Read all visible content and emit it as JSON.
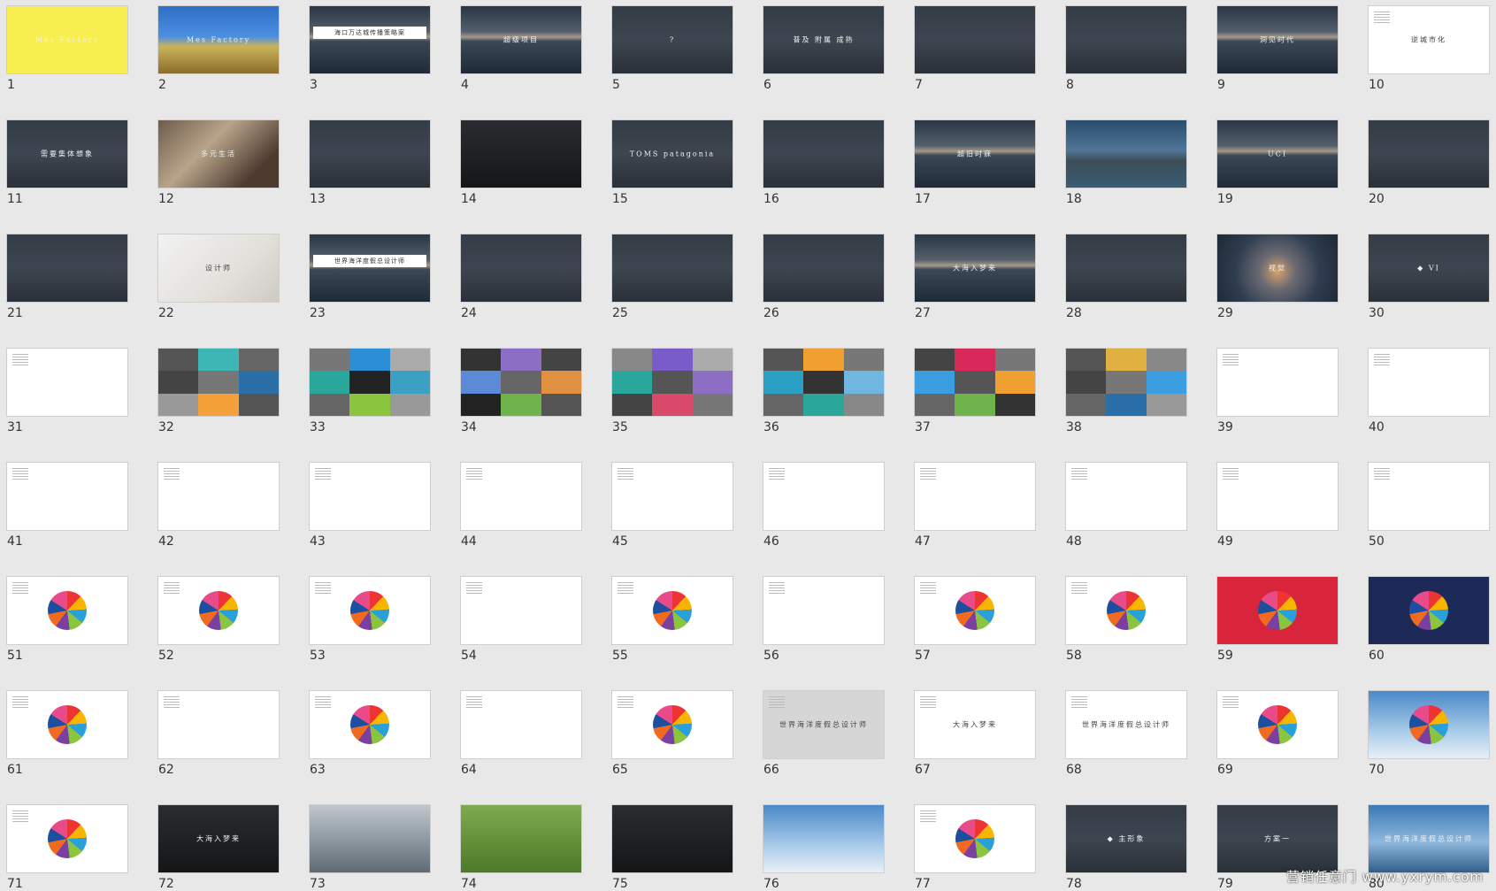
{
  "watermark": "营销任意门 www.yxrym.com",
  "slides": [
    {
      "num": "1",
      "style": "yellow",
      "text": "Mes Factory"
    },
    {
      "num": "2",
      "style": "blue",
      "text": "Mes Factory"
    },
    {
      "num": "3",
      "style": "sea",
      "banner": "海口万达城传播策略案"
    },
    {
      "num": "4",
      "style": "sea",
      "text": "超级项目"
    },
    {
      "num": "5",
      "style": "dark",
      "text": "?"
    },
    {
      "num": "6",
      "style": "dark",
      "text": "普及  附属  成熟"
    },
    {
      "num": "7",
      "style": "dark",
      "text": ""
    },
    {
      "num": "8",
      "style": "dark",
      "text": ""
    },
    {
      "num": "9",
      "style": "sea",
      "text": "洞见时代"
    },
    {
      "num": "10",
      "style": "white",
      "text": "逆城市化",
      "dark": true
    },
    {
      "num": "11",
      "style": "dark",
      "text": "需要集体想象"
    },
    {
      "num": "12",
      "style": "photo1",
      "text": "多元生活"
    },
    {
      "num": "13",
      "style": "dark",
      "text": ""
    },
    {
      "num": "14",
      "style": "dark2",
      "text": ""
    },
    {
      "num": "15",
      "style": "dark",
      "text": "TOMS  patagonia"
    },
    {
      "num": "16",
      "style": "dark",
      "text": ""
    },
    {
      "num": "17",
      "style": "sea",
      "text": "超旧时寐"
    },
    {
      "num": "18",
      "style": "lake",
      "text": ""
    },
    {
      "num": "19",
      "style": "sea",
      "text": "UCI"
    },
    {
      "num": "20",
      "style": "dark",
      "text": ""
    },
    {
      "num": "21",
      "style": "dark",
      "text": ""
    },
    {
      "num": "22",
      "style": "photo2",
      "text": "设计师",
      "dark": true
    },
    {
      "num": "23",
      "style": "sea",
      "banner": "世界海洋度假总设计师"
    },
    {
      "num": "24",
      "style": "dark",
      "text": ""
    },
    {
      "num": "25",
      "style": "dark",
      "text": ""
    },
    {
      "num": "26",
      "style": "dark",
      "text": ""
    },
    {
      "num": "27",
      "style": "sea",
      "text": "大海入梦来"
    },
    {
      "num": "28",
      "style": "dark",
      "text": ""
    },
    {
      "num": "29",
      "style": "glow",
      "text": "视觉"
    },
    {
      "num": "30",
      "style": "dark",
      "text": "◆  VI"
    },
    {
      "num": "31",
      "style": "white",
      "text": ""
    },
    {
      "num": "32",
      "style": "mosaic",
      "colors": [
        "#555",
        "#3fb6b6",
        "#666",
        "#444",
        "#777",
        "#2a6fa8",
        "#999",
        "#f3a23a",
        "#555"
      ]
    },
    {
      "num": "33",
      "style": "mosaic",
      "colors": [
        "#777",
        "#2c8ed6",
        "#aaa",
        "#2aa79b",
        "#222",
        "#3aa0c4",
        "#666",
        "#8bc43f",
        "#999"
      ]
    },
    {
      "num": "34",
      "style": "mosaic",
      "colors": [
        "#333",
        "#8c6fc4",
        "#444",
        "#5b8ad8",
        "#666",
        "#e09040",
        "#222",
        "#6fb44a",
        "#555"
      ]
    },
    {
      "num": "35",
      "style": "mosaic",
      "colors": [
        "#888",
        "#7a5cc8",
        "#aaa",
        "#2aa79b",
        "#555",
        "#8c6fc4",
        "#444",
        "#d94a6a",
        "#777"
      ]
    },
    {
      "num": "36",
      "style": "mosaic",
      "colors": [
        "#555",
        "#f0a030",
        "#777",
        "#2aa0c4",
        "#333",
        "#6fb6e0",
        "#666",
        "#2aa79b",
        "#888"
      ]
    },
    {
      "num": "37",
      "style": "mosaic",
      "colors": [
        "#444",
        "#d9285a",
        "#777",
        "#3a9ee0",
        "#555",
        "#f0a030",
        "#666",
        "#6fb44a",
        "#333"
      ]
    },
    {
      "num": "38",
      "style": "mosaic",
      "colors": [
        "#555",
        "#e0b040",
        "#888",
        "#444",
        "#777",
        "#3a9ee0",
        "#666",
        "#2a6fa8",
        "#999"
      ]
    },
    {
      "num": "39",
      "style": "white",
      "text": ""
    },
    {
      "num": "40",
      "style": "white",
      "text": ""
    },
    {
      "num": "41",
      "style": "white",
      "text": ""
    },
    {
      "num": "42",
      "style": "white",
      "text": ""
    },
    {
      "num": "43",
      "style": "white",
      "text": ""
    },
    {
      "num": "44",
      "style": "white",
      "text": ""
    },
    {
      "num": "45",
      "style": "white",
      "text": ""
    },
    {
      "num": "46",
      "style": "white",
      "text": ""
    },
    {
      "num": "47",
      "style": "white",
      "text": ""
    },
    {
      "num": "48",
      "style": "white",
      "text": ""
    },
    {
      "num": "49",
      "style": "white",
      "text": ""
    },
    {
      "num": "50",
      "style": "white",
      "text": ""
    },
    {
      "num": "51",
      "style": "white",
      "petals": true
    },
    {
      "num": "52",
      "style": "white",
      "petals": true
    },
    {
      "num": "53",
      "style": "white",
      "petals": true
    },
    {
      "num": "54",
      "style": "white",
      "text": ""
    },
    {
      "num": "55",
      "style": "white",
      "petals": true
    },
    {
      "num": "56",
      "style": "white",
      "text": ""
    },
    {
      "num": "57",
      "style": "white",
      "petals": true
    },
    {
      "num": "58",
      "style": "white",
      "petals": true
    },
    {
      "num": "59",
      "style": "red",
      "petals": true
    },
    {
      "num": "60",
      "style": "navy",
      "petals": true
    },
    {
      "num": "61",
      "style": "white",
      "petals": true
    },
    {
      "num": "62",
      "style": "white",
      "text": ""
    },
    {
      "num": "63",
      "style": "white",
      "petals": true
    },
    {
      "num": "64",
      "style": "white",
      "text": ""
    },
    {
      "num": "65",
      "style": "white",
      "petals": true
    },
    {
      "num": "66",
      "style": "gray",
      "text": "世界海洋度假总设计师",
      "dark": true
    },
    {
      "num": "67",
      "style": "white",
      "text": "大海入梦来",
      "dark": true
    },
    {
      "num": "68",
      "style": "white",
      "text": "世界海洋度假总设计师",
      "dark": true
    },
    {
      "num": "69",
      "style": "white",
      "petals": true
    },
    {
      "num": "70",
      "style": "sky",
      "petals": true
    },
    {
      "num": "71",
      "style": "white",
      "petals": true
    },
    {
      "num": "72",
      "style": "dark2",
      "text": "大海入梦来"
    },
    {
      "num": "73",
      "style": "street",
      "text": ""
    },
    {
      "num": "74",
      "style": "grass",
      "text": ""
    },
    {
      "num": "75",
      "style": "dark2",
      "text": ""
    },
    {
      "num": "76",
      "style": "sky",
      "text": ""
    },
    {
      "num": "77",
      "style": "white",
      "petals": true
    },
    {
      "num": "78",
      "style": "dark",
      "text": "◆  主形象"
    },
    {
      "num": "79",
      "style": "dark",
      "text": "方案一"
    },
    {
      "num": "80",
      "style": "bill",
      "text": "世界海洋度假总设计师"
    }
  ]
}
